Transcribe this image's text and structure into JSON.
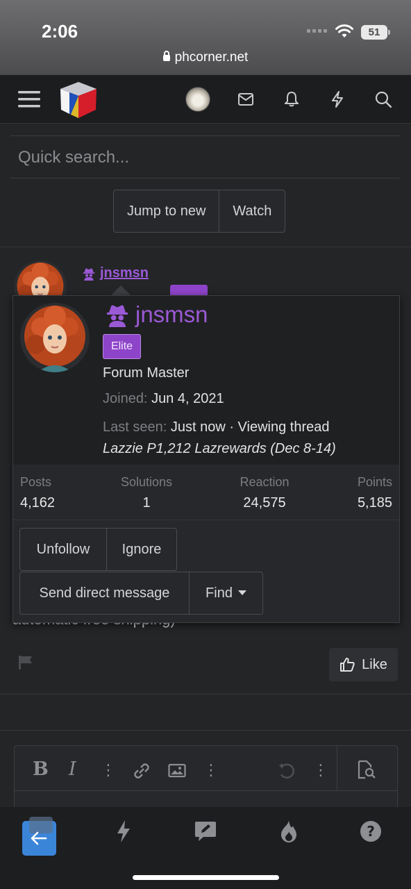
{
  "status_bar": {
    "time": "2:06",
    "battery": "51",
    "url": "phcorner.net"
  },
  "header": {
    "menu_icon": "hamburger-icon",
    "logo": "phcorner-cube-logo",
    "icons": [
      "avatar",
      "envelope-icon",
      "bell-icon",
      "lightning-icon",
      "search-icon"
    ]
  },
  "search": {
    "placeholder": "Quick search..."
  },
  "thread_buttons": {
    "jump": "Jump to new",
    "watch": "Watch"
  },
  "post": {
    "username": "jnsmsn",
    "text": "automatic free shipping)",
    "like_label": "Like"
  },
  "profile_card": {
    "username": "jnsmsn",
    "badge": "Elite",
    "user_title": "Forum Master",
    "joined_label": "Joined:",
    "joined_value": "Jun 4, 2021",
    "last_seen_label": "Last seen:",
    "last_seen_value": "Just now · Viewing thread",
    "thread_title": "Lazzie P1,212 Lazrewards (Dec 8-14)",
    "stats": [
      {
        "label": "Posts",
        "value": "4,162"
      },
      {
        "label": "Solutions",
        "value": "1"
      },
      {
        "label": "Reaction",
        "value": "24,575"
      },
      {
        "label": "Points",
        "value": "5,185"
      }
    ],
    "actions": {
      "unfollow": "Unfollow",
      "ignore": "Ignore",
      "dm": "Send direct message",
      "find": "Find"
    }
  },
  "editor": {
    "toolbar": [
      "bold",
      "italic",
      "more",
      "link-icon",
      "image-icon",
      "more",
      "undo-icon",
      "more",
      "preview-icon"
    ],
    "bold_label": "B",
    "italic_label": "I"
  },
  "tabbar": [
    "back-arrow-icon",
    "lightning-icon",
    "compose-icon",
    "fire-icon",
    "help-icon"
  ],
  "colors": {
    "accent_purple": "#9b59d6",
    "badge_purple": "#8e44c9",
    "tab_active": "#3b85d9"
  }
}
